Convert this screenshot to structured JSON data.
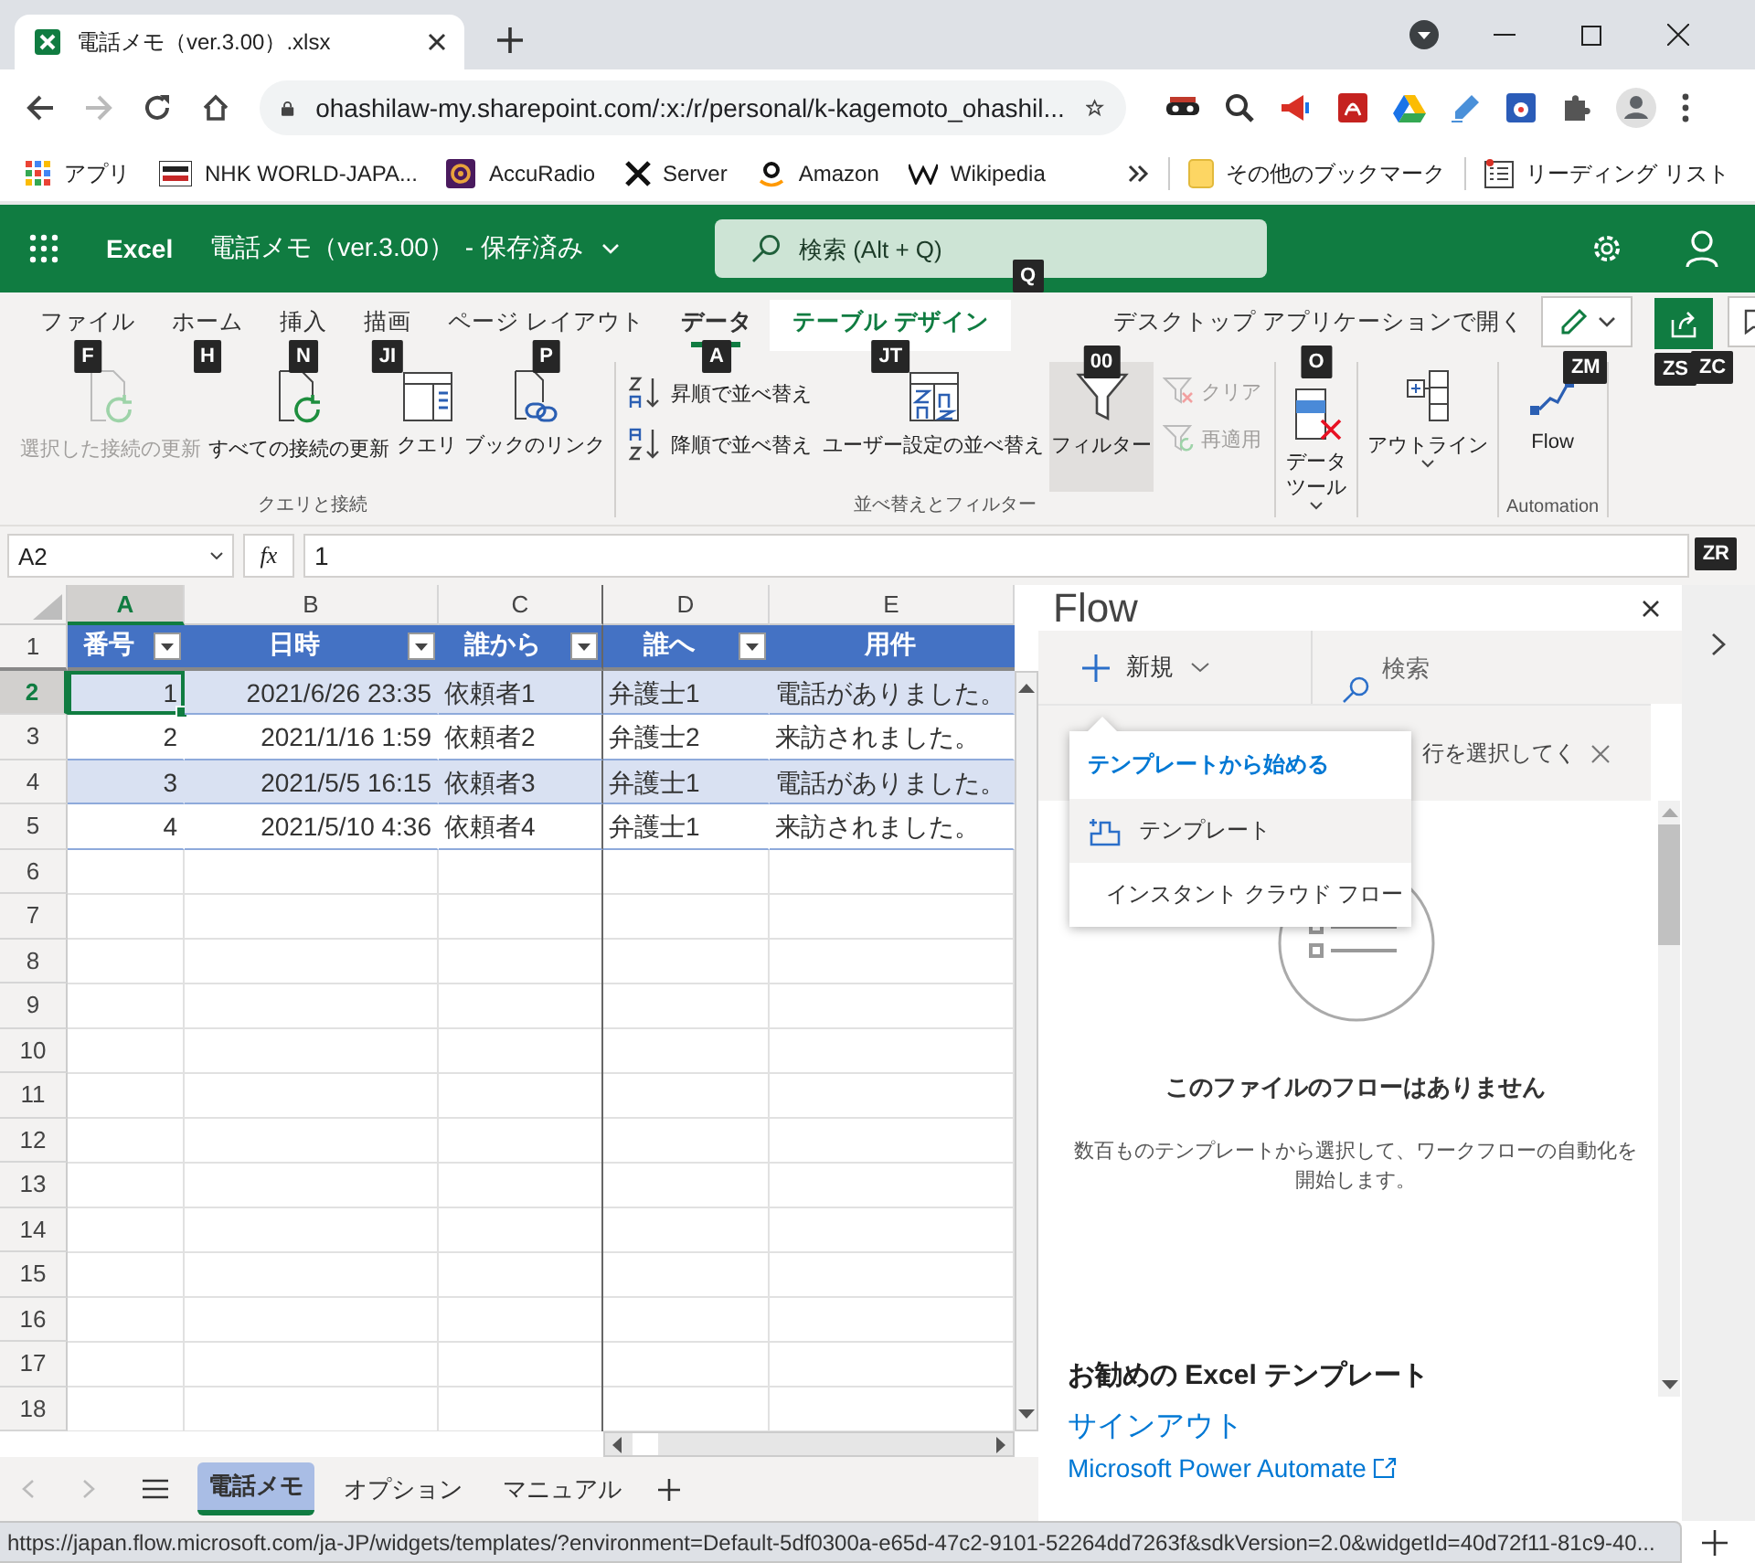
{
  "browser": {
    "tabs": [
      {
        "title": "電話メモ（ver.3.00）.xlsx",
        "selected": true
      }
    ],
    "address": "ohashilaw-my.sharepoint.com/:x:/r/personal/k-kagemoto_ohashil...",
    "bookmarks": [
      {
        "label": "アプリ"
      },
      {
        "label": "NHK WORLD-JAPA..."
      },
      {
        "label": "AccuRadio"
      },
      {
        "label": "Server"
      },
      {
        "label": "Amazon"
      },
      {
        "label": "Wikipedia"
      }
    ],
    "other_bookmarks": "その他のブックマーク",
    "reading_list": "リーディング リスト"
  },
  "excel": {
    "app": "Excel",
    "title": "電話メモ（ver.3.00）",
    "status": "- 保存済み",
    "search_placeholder": "検索 (Alt + Q)",
    "search_keytip": "Q"
  },
  "ribbon": {
    "tabs": [
      {
        "label": "ファイル",
        "keytip": "F",
        "kind": "standard",
        "selected": false
      },
      {
        "label": "ホーム",
        "keytip": "H",
        "kind": "standard",
        "selected": false
      },
      {
        "label": "挿入",
        "keytip": "N",
        "kind": "standard",
        "selected": false
      },
      {
        "label": "描画",
        "keytip": "JI",
        "kind": "standard",
        "selected": false
      },
      {
        "label": "ページ レイアウト",
        "keytip": "P",
        "kind": "standard",
        "selected": false
      },
      {
        "label": "データ",
        "keytip": "A",
        "kind": "standard",
        "selected": true
      },
      {
        "label": "テーブル デザイン",
        "keytip": "JT",
        "kind": "contextual",
        "selected": false
      }
    ],
    "open_desktop": "デスクトップ アプリケーションで開く",
    "edit_keytip": "ZM",
    "share_keytip": "ZS",
    "comments_keytip": "ZC",
    "groups": [
      {
        "label": "クエリと接続",
        "commands": [
          {
            "label": "選択した接続の更新",
            "kind": "large",
            "disabled": true,
            "on": false,
            "dropdown": false
          },
          {
            "label": "すべての接続の更新",
            "kind": "large",
            "disabled": false,
            "on": false,
            "dropdown": false
          },
          {
            "label": "クエリ",
            "kind": "large",
            "disabled": false,
            "on": false,
            "dropdown": false
          },
          {
            "label": "ブックのリンク",
            "kind": "large",
            "disabled": false,
            "on": false,
            "dropdown": false
          }
        ]
      },
      {
        "label": "並べ替えとフィルター",
        "commands": [
          {
            "label": "昇順で並べ替え",
            "kind": "small",
            "disabled": false,
            "on": false,
            "dropdown": false
          },
          {
            "label": "降順で並べ替え",
            "kind": "small",
            "disabled": false,
            "on": false,
            "dropdown": false
          },
          {
            "label": "ユーザー設定の並べ替え",
            "kind": "large",
            "disabled": false,
            "on": false,
            "dropdown": false
          },
          {
            "label": "フィルター",
            "kind": "large",
            "disabled": false,
            "on": true,
            "dropdown": false,
            "keytip": "00"
          },
          {
            "label": "クリア",
            "kind": "small",
            "disabled": true,
            "on": false,
            "dropdown": false
          },
          {
            "label": "再適用",
            "kind": "small",
            "disabled": true,
            "on": false,
            "dropdown": false
          }
        ]
      },
      {
        "commands": [
          {
            "label": "データツール",
            "kind": "large",
            "disabled": false,
            "on": false,
            "dropdown": true,
            "keytip": "O"
          }
        ]
      },
      {
        "commands": [
          {
            "label": "アウトライン",
            "kind": "large",
            "disabled": false,
            "on": false,
            "dropdown": true
          }
        ]
      },
      {
        "label": "Automation",
        "commands": [
          {
            "label": "Flow",
            "kind": "large",
            "disabled": false,
            "on": false,
            "dropdown": false
          }
        ]
      }
    ]
  },
  "formula_bar": {
    "name_box": "A2",
    "function_label": "fx",
    "value": "1",
    "keytip": "ZR"
  },
  "sheet": {
    "columns": [
      {
        "letter": "A",
        "selected": true
      },
      {
        "letter": "B",
        "selected": false
      },
      {
        "letter": "C",
        "selected": false
      },
      {
        "letter": "D",
        "selected": false
      },
      {
        "letter": "E",
        "selected": false
      }
    ],
    "row_numbers": [
      {
        "label": "1",
        "selected": false
      },
      {
        "label": "2",
        "selected": true
      },
      {
        "label": "3",
        "selected": false
      },
      {
        "label": "4",
        "selected": false
      },
      {
        "label": "5",
        "selected": false
      },
      {
        "label": "6",
        "selected": false
      },
      {
        "label": "7",
        "selected": false
      },
      {
        "label": "8",
        "selected": false
      },
      {
        "label": "9",
        "selected": false
      },
      {
        "label": "10",
        "selected": false
      },
      {
        "label": "11",
        "selected": false
      },
      {
        "label": "12",
        "selected": false
      },
      {
        "label": "13",
        "selected": false
      },
      {
        "label": "14",
        "selected": false
      },
      {
        "label": "15",
        "selected": false
      },
      {
        "label": "16",
        "selected": false
      },
      {
        "label": "17",
        "selected": false
      },
      {
        "label": "18",
        "selected": false
      }
    ],
    "table": {
      "headers": [
        {
          "label": "番号",
          "filter": true
        },
        {
          "label": "日時",
          "filter": true
        },
        {
          "label": "誰から",
          "filter": true
        },
        {
          "label": "誰へ",
          "filter": true
        },
        {
          "label": "用件",
          "filter": false
        }
      ],
      "rows": [
        [
          "1",
          "2021/6/26 23:35",
          "依頼者1",
          "弁護士1",
          "電話がありました。"
        ],
        [
          "2",
          "2021/1/16 1:59",
          "依頼者2",
          "弁護士2",
          "来訪されました。"
        ],
        [
          "3",
          "2021/5/5 16:15",
          "依頼者3",
          "弁護士1",
          "電話がありました。"
        ],
        [
          "4",
          "2021/5/10 4:36",
          "依頼者4",
          "弁護士1",
          "来訪されました。"
        ]
      ]
    },
    "tabs": [
      {
        "label": "電話メモ",
        "selected": true
      },
      {
        "label": "オプション",
        "selected": false
      },
      {
        "label": "マニュアル",
        "selected": false
      }
    ]
  },
  "flow_pane": {
    "title": "Flow",
    "new_label": "新規",
    "search_placeholder": "検索",
    "notice": "行を選択してく",
    "menu": {
      "heading": "テンプレートから始める",
      "items": [
        {
          "label": "テンプレート",
          "highlighted": true
        },
        {
          "label": "インスタント クラウド フロー",
          "highlighted": false
        }
      ]
    },
    "empty_title": "このファイルのフローはありません",
    "empty_text": "数百ものテンプレートから選択して、ワークフローの自動化を開始します。",
    "recommend_heading": "お勧めの Excel テンプレート",
    "links": [
      {
        "label": "サインアウト",
        "external": false
      },
      {
        "label": "Microsoft Power Automate",
        "external": true
      }
    ]
  },
  "status_url": "https://japan.flow.microsoft.com/ja-JP/widgets/templates/?environment=Default-5df0300a-e65d-47c2-9101-52264dd7263f&sdkVersion=2.0&widgetId=40d72f11-81c9-40..."
}
